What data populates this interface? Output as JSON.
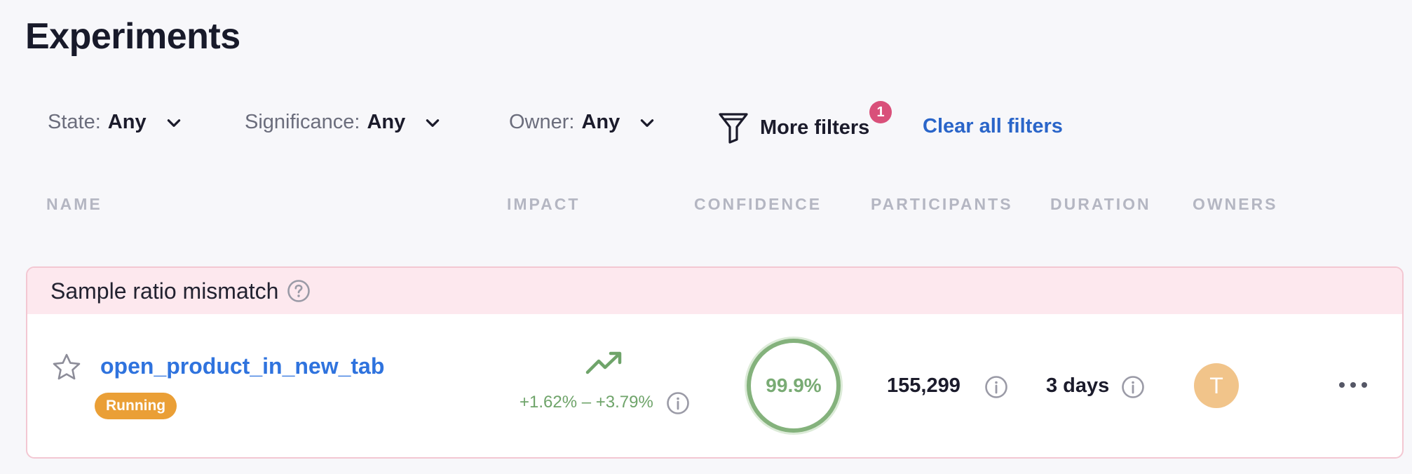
{
  "page": {
    "title": "Experiments"
  },
  "filters": {
    "state": {
      "label": "State:",
      "value": "Any"
    },
    "significance": {
      "label": "Significance:",
      "value": "Any"
    },
    "owner": {
      "label": "Owner:",
      "value": "Any"
    },
    "more": {
      "label": "More filters",
      "badge_count": "1"
    },
    "clear_all": "Clear all filters"
  },
  "columns": [
    "NAME",
    "IMPACT",
    "CONFIDENCE",
    "PARTICIPANTS",
    "DURATION",
    "OWNERS"
  ],
  "groups": [
    {
      "title": "Sample ratio mismatch",
      "experiments": [
        {
          "name": "open_product_in_new_tab",
          "status": "Running",
          "impact_range": "+1.62% – +3.79%",
          "confidence": "99.9%",
          "participants": "155,299",
          "duration": "3 days",
          "owner_initial": "T"
        }
      ]
    }
  ],
  "colors": {
    "accent_link": "#2f73de",
    "badge_pink": "#d9507a",
    "running_orange": "#ea9f36",
    "positive_green": "#79ab74",
    "warning_bg": "#fde8ee",
    "avatar": "#f1c48a"
  },
  "icons": {
    "chevron": "chevron-down-icon",
    "funnel": "filter-funnel-icon",
    "help": "help-circle-icon",
    "star": "star-outline-icon",
    "trend": "trending-up-icon",
    "info": "info-circle-icon",
    "more": "more-horizontal-icon"
  }
}
